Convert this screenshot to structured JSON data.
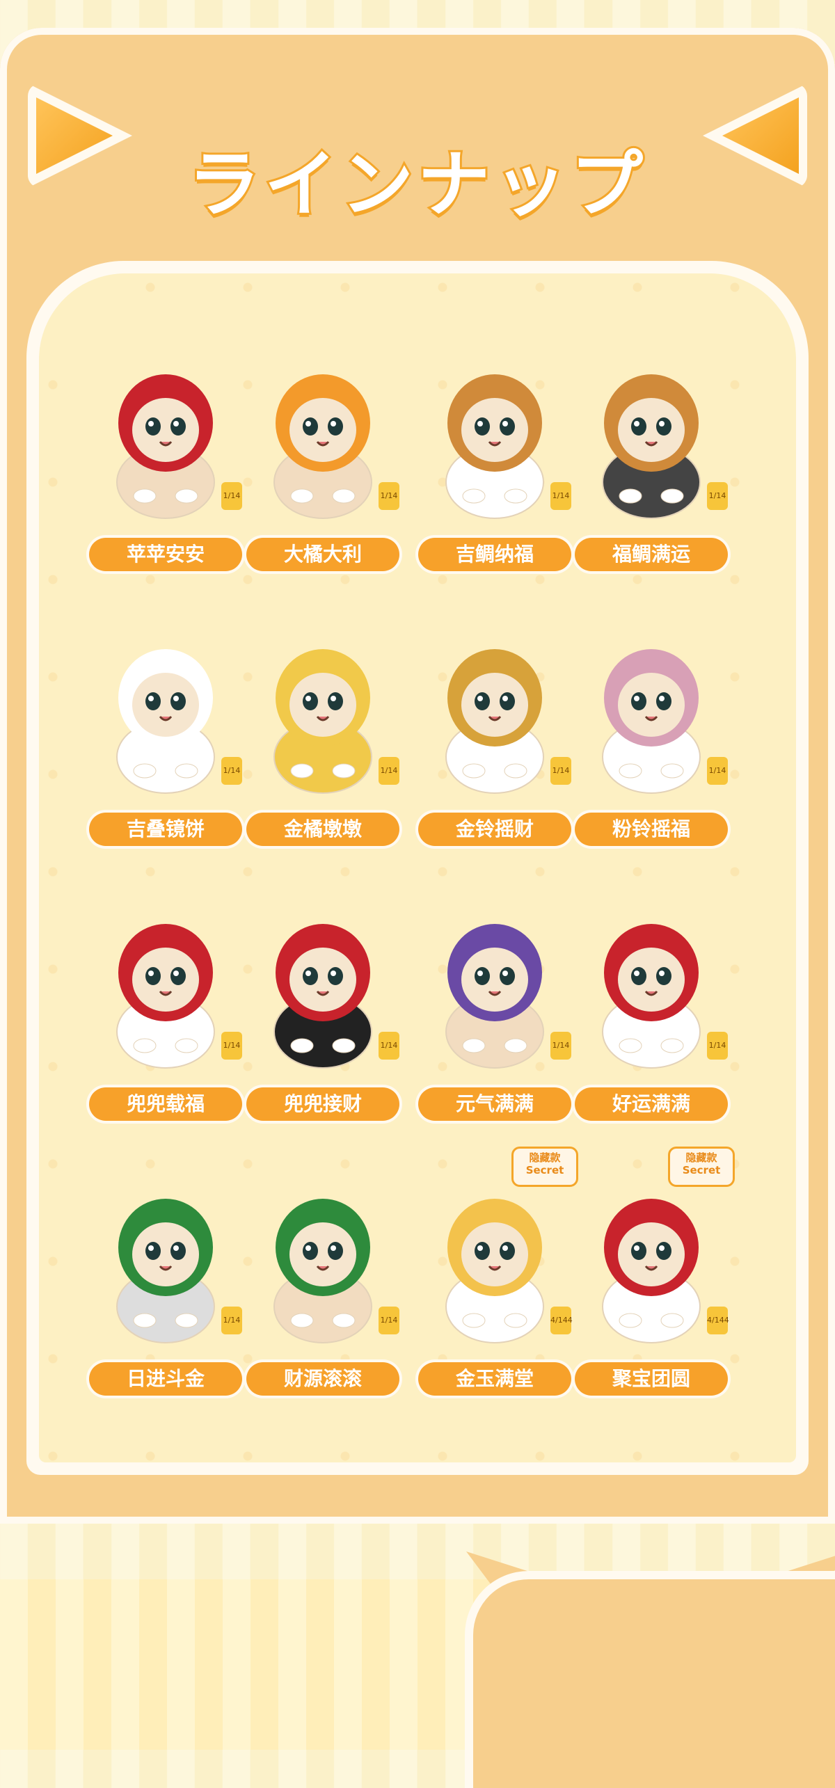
{
  "header": {
    "title": "ラインナップ"
  },
  "items": [
    {
      "label": "苹苹安安",
      "badge": "1/14",
      "figure": "apple-hat-cat",
      "colors": {
        "hat": "#c8232c",
        "body": "#f2dcc0"
      }
    },
    {
      "label": "大橘大利",
      "badge": "1/14",
      "figure": "orange-hat-cat",
      "colors": {
        "hat": "#f39a2b",
        "body": "#f2dcc0"
      }
    },
    {
      "label": "吉鲷纳福",
      "badge": "1/14",
      "figure": "taiyaki-cat",
      "colors": {
        "hat": "#d08a3a",
        "body": "#ffffff"
      }
    },
    {
      "label": "福鲷满运",
      "badge": "1/14",
      "figure": "taiyaki-black-cat",
      "colors": {
        "hat": "#d08a3a",
        "body": "#444444"
      }
    },
    {
      "label": "吉叠镜饼",
      "badge": "1/14",
      "figure": "mochi-white-cat",
      "colors": {
        "hat": "#ffffff",
        "body": "#ffffff"
      }
    },
    {
      "label": "金橘墩墩",
      "badge": "1/14",
      "figure": "mochi-yellow-cat",
      "colors": {
        "hat": "#f1c94a",
        "body": "#f1c94a"
      }
    },
    {
      "label": "金铃摇财",
      "badge": "1/14",
      "figure": "gold-bell-cat",
      "colors": {
        "hat": "#d7a23a",
        "body": "#ffffff"
      }
    },
    {
      "label": "粉铃摇福",
      "badge": "1/14",
      "figure": "pink-bell-cat",
      "colors": {
        "hat": "#d8a0b6",
        "body": "#ffffff"
      }
    },
    {
      "label": "兜兜载福",
      "badge": "1/14",
      "figure": "pouch-grey-cat",
      "colors": {
        "hat": "#c8232c",
        "body": "#ffffff"
      }
    },
    {
      "label": "兜兜接财",
      "badge": "1/14",
      "figure": "pouch-black-cat",
      "colors": {
        "hat": "#c8232c",
        "body": "#222222"
      }
    },
    {
      "label": "元气满满",
      "badge": "1/14",
      "figure": "lucky-orange-cat",
      "colors": {
        "hat": "#6a4aa5",
        "body": "#f2dcc0"
      }
    },
    {
      "label": "好运满满",
      "badge": "1/14",
      "figure": "lucky-white-cat",
      "colors": {
        "hat": "#c8232c",
        "body": "#ffffff"
      }
    },
    {
      "label": "日进斗金",
      "badge": "1/14",
      "figure": "coin-grey-cat",
      "colors": {
        "hat": "#2e8b3c",
        "body": "#dddddd"
      }
    },
    {
      "label": "财源滚滚",
      "badge": "1/14",
      "figure": "coin-orange-cat",
      "colors": {
        "hat": "#2e8b3c",
        "body": "#f2dcc0"
      }
    },
    {
      "label": "金玉满堂",
      "badge": "4/144",
      "figure": "bowl-white-cat",
      "secret": true,
      "colors": {
        "hat": "#f3c24c",
        "body": "#ffffff"
      }
    },
    {
      "label": "聚宝团圆",
      "badge": "4/144",
      "figure": "bowl-red-cat",
      "secret": true,
      "colors": {
        "hat": "#c8232c",
        "body": "#ffffff"
      }
    }
  ],
  "secret_tag": {
    "line1": "隐藏款",
    "line2": "Secret"
  }
}
